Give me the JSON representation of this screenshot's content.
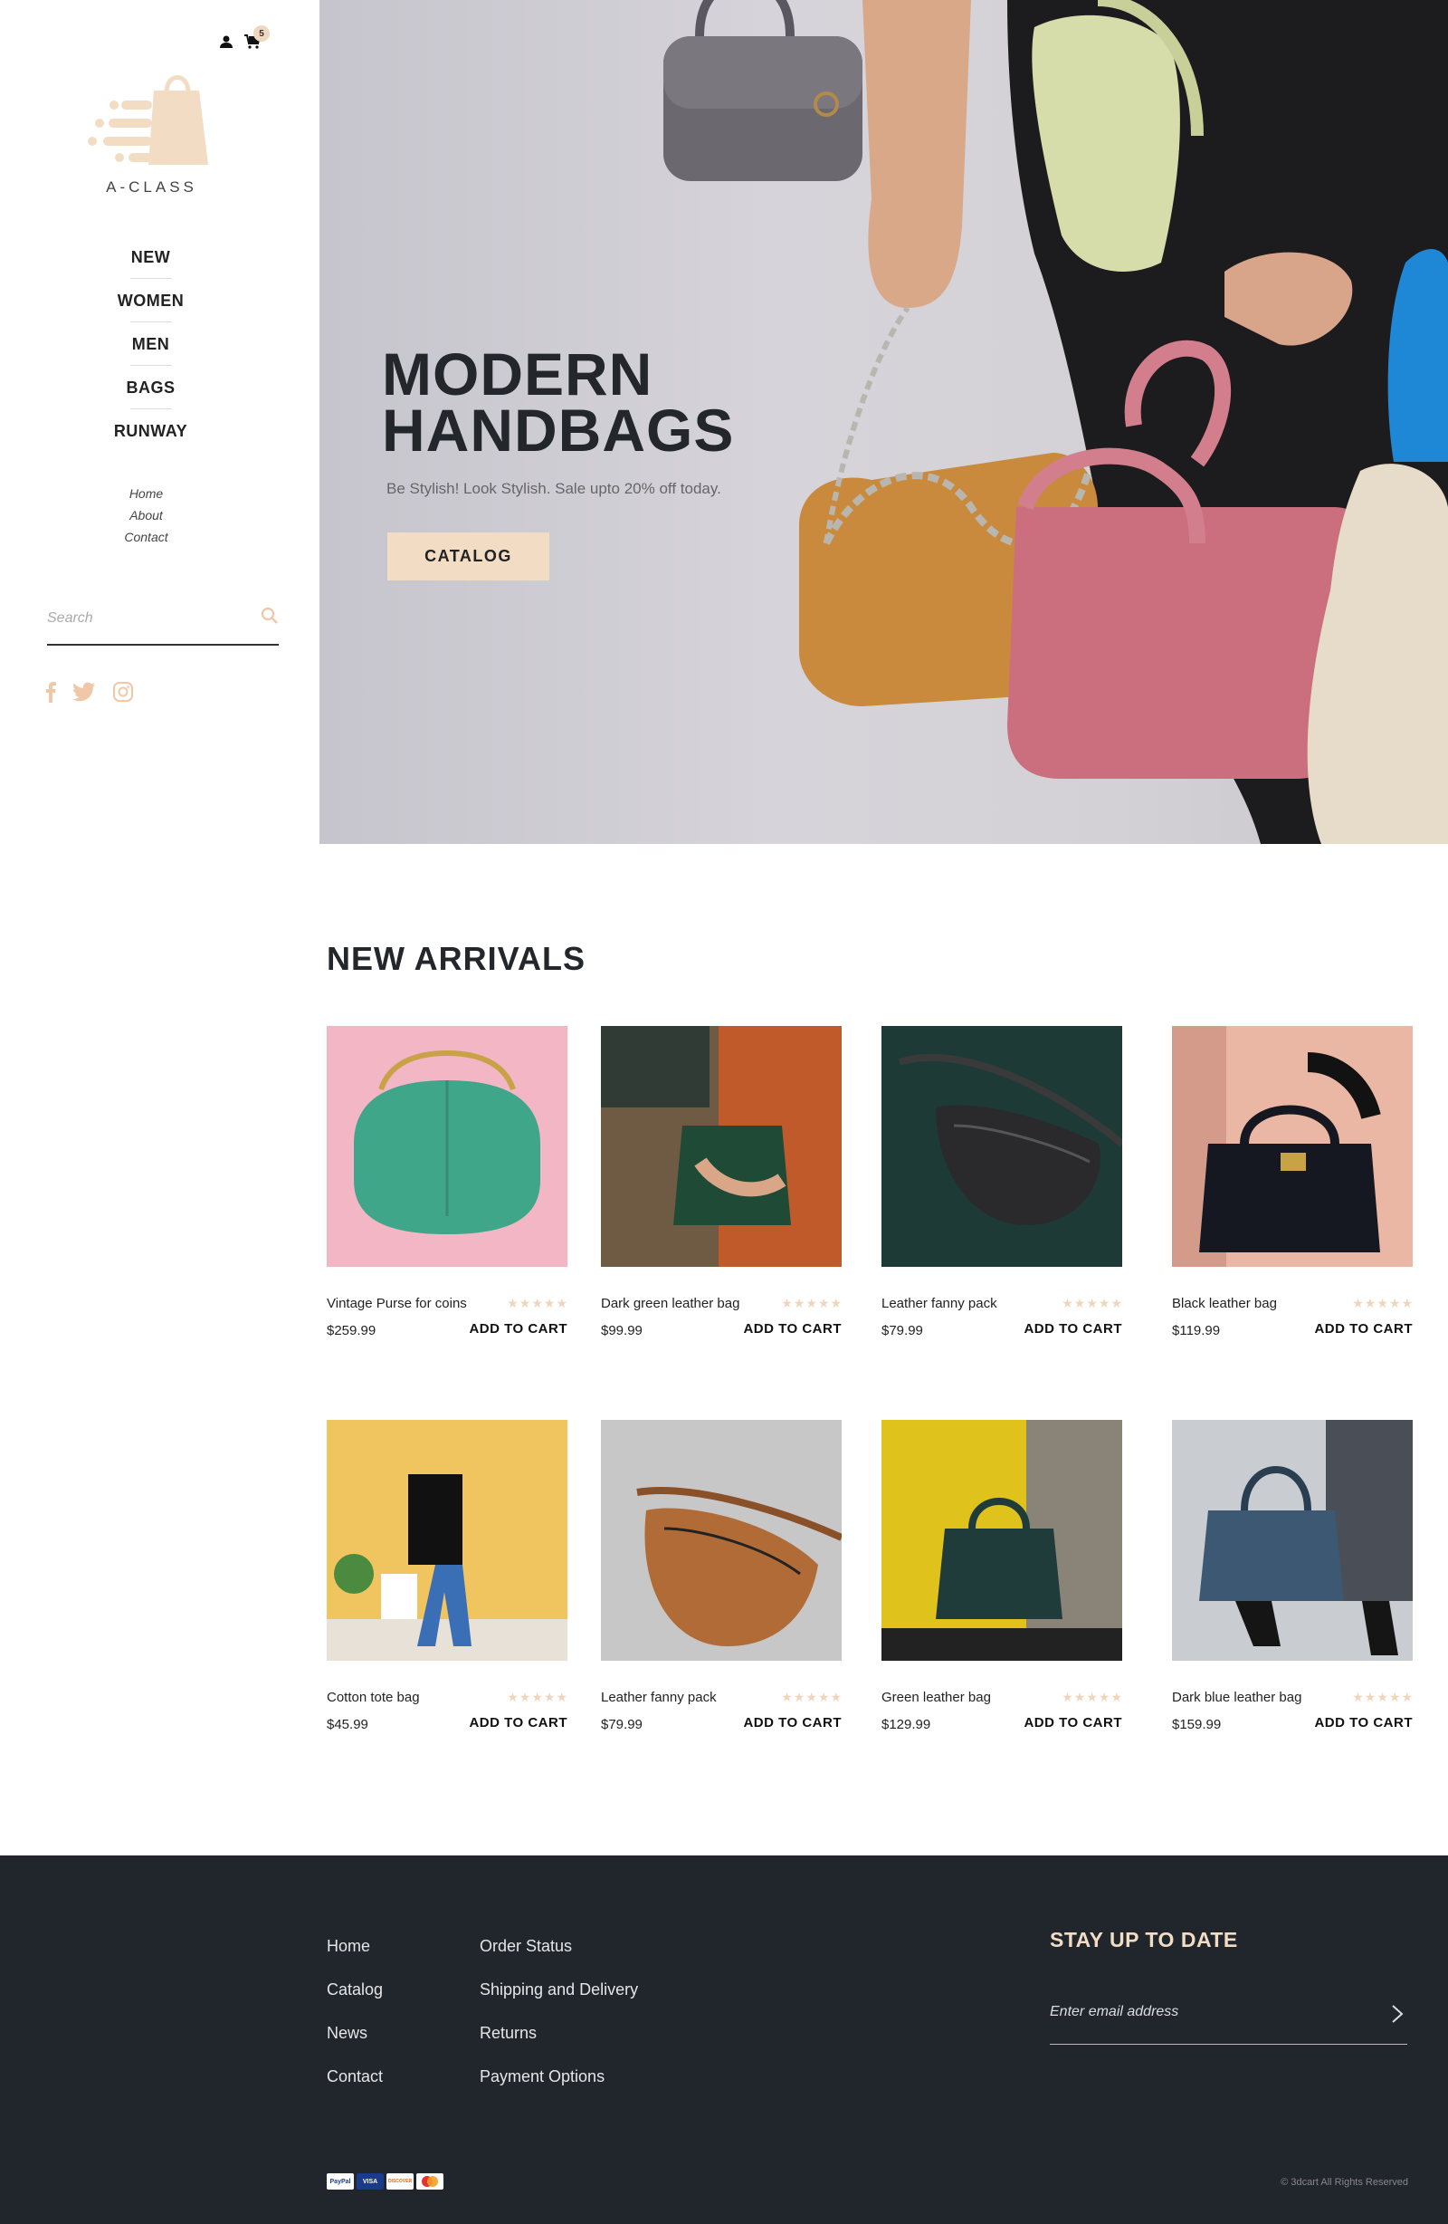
{
  "sidebar": {
    "cart_count": "5",
    "logo_text": "A-CLASS",
    "main_nav": [
      "NEW",
      "WOMEN",
      "MEN",
      "BAGS",
      "RUNWAY"
    ],
    "sub_nav": [
      "Home",
      "About",
      "Contact"
    ],
    "search_placeholder": "Search",
    "socials": [
      "facebook-icon",
      "twitter-icon",
      "instagram-icon"
    ]
  },
  "hero": {
    "title_line1": "MODERN",
    "title_line2": "HANDBAGS",
    "subtitle": "Be Stylish! Look Stylish. Sale upto 20% off today.",
    "cta": "CATALOG"
  },
  "arrivals": {
    "title": "NEW ARRIVALS",
    "add_label": "ADD TO CART",
    "products": [
      {
        "name": "Vintage Purse for coins",
        "price": "$259.99",
        "rating": 5
      },
      {
        "name": "Dark green leather bag",
        "price": "$99.99",
        "rating": 5
      },
      {
        "name": "Leather fanny pack",
        "price": "$79.99",
        "rating": 5
      },
      {
        "name": "Black leather bag",
        "price": "$119.99",
        "rating": 5
      },
      {
        "name": "Cotton tote bag",
        "price": "$45.99",
        "rating": 5
      },
      {
        "name": "Leather fanny pack",
        "price": "$79.99",
        "rating": 5
      },
      {
        "name": "Green leather bag",
        "price": "$129.99",
        "rating": 5
      },
      {
        "name": "Dark blue leather bag",
        "price": "$159.99",
        "rating": 5
      }
    ]
  },
  "footer": {
    "col1": [
      "Home",
      "Catalog",
      "News",
      "Contact"
    ],
    "col2": [
      "Order Status",
      "Shipping and Delivery",
      "Returns",
      "Payment Options"
    ],
    "stay_title": "STAY UP TO DATE",
    "email_placeholder": "Enter email address",
    "payments": [
      "PayPal",
      "VISA",
      "DISCOVER",
      "MC"
    ],
    "copyright": "© 3dcart All Rights Reserved"
  },
  "colors": {
    "accent": "#f2dcc4",
    "dark": "#21252c",
    "text": "#23272b"
  }
}
